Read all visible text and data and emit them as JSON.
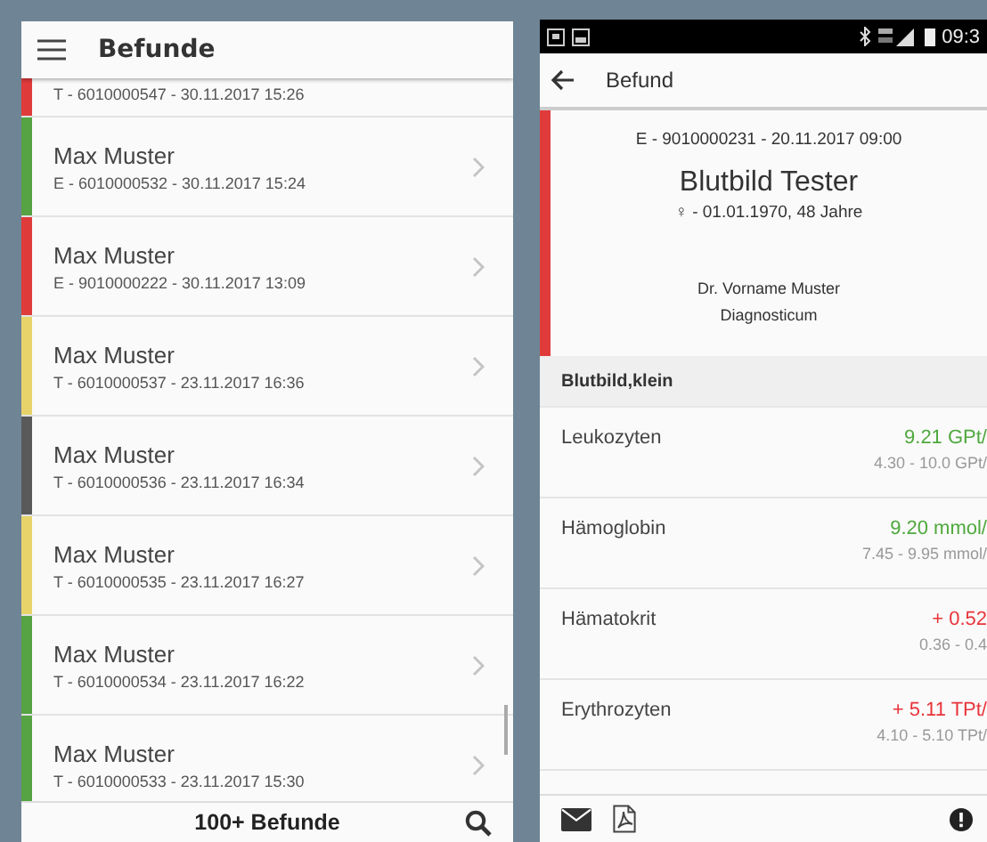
{
  "list_screen": {
    "title": "Befunde",
    "items": [
      {
        "id_line": "T - 6010000547 - 30.11.2017 15:26",
        "color": "#e03b3b"
      },
      {
        "name": "Max Muster",
        "id_line": "E - 6010000532 - 30.11.2017 15:24",
        "color": "#55a343"
      },
      {
        "name": "Max Muster",
        "id_line": "E - 9010000222 - 30.11.2017 13:09",
        "color": "#e03b3b"
      },
      {
        "name": "Max Muster",
        "id_line": "T - 6010000537 - 23.11.2017 16:36",
        "color": "#e8d36a"
      },
      {
        "name": "Max Muster",
        "id_line": "T - 6010000536 - 23.11.2017 16:34",
        "color": "#595959"
      },
      {
        "name": "Max Muster",
        "id_line": "T - 6010000535 - 23.11.2017 16:27",
        "color": "#e8d36a"
      },
      {
        "name": "Max Muster",
        "id_line": "T - 6010000534 - 23.11.2017 16:22",
        "color": "#55a343"
      },
      {
        "name": "Max Muster",
        "id_line": "T - 6010000533 - 23.11.2017 15:30",
        "color": "#55a343"
      }
    ],
    "footer": "100+ Befunde"
  },
  "detail_screen": {
    "status_bar": {
      "time": "09:3"
    },
    "title": "Befund",
    "report": {
      "id_line": "E - 9010000231 - 20.11.2017 09:00",
      "title": "Blutbild Tester",
      "patient_line": "♀ - 01.01.1970, 48 Jahre",
      "doctor": "Dr. Vorname Muster",
      "lab": "Diagnosticum",
      "color": "#e03b3b"
    },
    "section": "Blutbild,klein",
    "results": [
      {
        "name": "Leukozyten",
        "value": "9.21 GPt/",
        "range": "4.30 - 10.0 GPt/",
        "color": "#4fa83d"
      },
      {
        "name": "Hämoglobin",
        "value": "9.20 mmol/",
        "range": "7.45 - 9.95 mmol/",
        "color": "#4fa83d"
      },
      {
        "name": "Hämatokrit",
        "value": "+ 0.52",
        "range": "0.36 - 0.4",
        "color": "#e8343a"
      },
      {
        "name": "Erythrozyten",
        "value": "+ 5.11 TPt/",
        "range": "4.10 - 5.10 TPt/",
        "color": "#e8343a"
      }
    ]
  }
}
